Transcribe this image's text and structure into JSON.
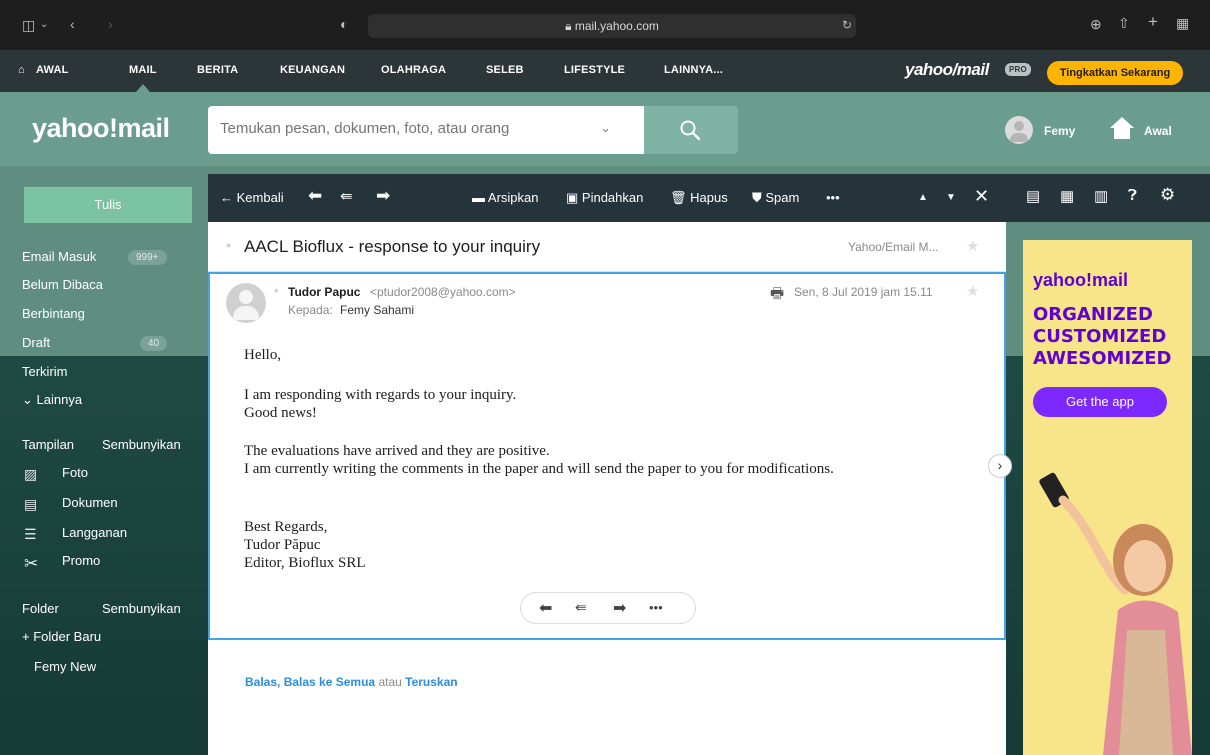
{
  "browser": {
    "url": "mail.yahoo.com"
  },
  "topnav": {
    "items": [
      "AWAL",
      "MAIL",
      "BERITA",
      "KEUANGAN",
      "OLAHRAGA",
      "SELEB",
      "LIFESTYLE",
      "LAINNYA..."
    ],
    "brand": "yahoo/mail",
    "pro_badge": "PRO",
    "upgrade_label": "Tingkatkan Sekarang"
  },
  "header": {
    "logo": "yahoo!mail",
    "search_placeholder": "Temukan pesan, dokumen, foto, atau orang",
    "user_name": "Femy",
    "home_label": "Awal"
  },
  "sidebar": {
    "compose_label": "Tulis",
    "folders": [
      {
        "label": "Email Masuk",
        "count": "999+"
      },
      {
        "label": "Belum Dibaca",
        "count": ""
      },
      {
        "label": "Berbintang",
        "count": ""
      },
      {
        "label": "Draft",
        "count": "40"
      },
      {
        "label": "Terkirim",
        "count": ""
      },
      {
        "label": "Lainnya",
        "count": ""
      }
    ],
    "views_title": "Tampilan",
    "views_hide": "Sembunyikan",
    "views": [
      "Foto",
      "Dokumen",
      "Langganan",
      "Promo"
    ],
    "folder_title": "Folder",
    "folder_hide": "Sembunyikan",
    "new_folder": "+ Folder Baru",
    "custom_folders": [
      "Femy New"
    ]
  },
  "toolbar": {
    "back_label": "Kembali",
    "archive_label": "Arsipkan",
    "move_label": "Pindahkan",
    "delete_label": "Hapus",
    "spam_label": "Spam",
    "more_label": "•••"
  },
  "email": {
    "subject": "AACL Bioflux - response to your inquiry",
    "folder_tag": "Yahoo/Email M...",
    "sender_name": "Tudor Papuc",
    "sender_email": "<ptudor2008@yahoo.com>",
    "to_label": "Kepada:",
    "to_name": "Femy Sahami",
    "date": "Sen, 8 Jul 2019 jam 15.11",
    "body": [
      "Hello,",
      "I am responding with regards to your inquiry.",
      "Good news!",
      "The evaluations have arrived and they are positive.",
      "I am currently writing the comments in the paper and will send the paper to you for modifications.",
      "Best Regards,",
      "Tudor Păpuc",
      "Editor, Bioflux SRL"
    ]
  },
  "reply_links": {
    "reply": "Balas,",
    "reply_all": "Balas ke Semua",
    "or": "atau",
    "forward": "Teruskan"
  },
  "ad": {
    "logo": "yahoo!mail",
    "line1": "ORGANIZED",
    "line2": "CUSTOMIZED",
    "line3": "AWESOMIZED",
    "cta": "Get the app"
  }
}
